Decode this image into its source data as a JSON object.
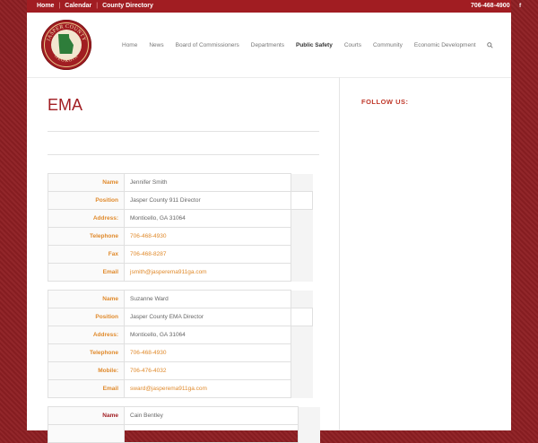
{
  "topbar": {
    "links": [
      "Home",
      "Calendar",
      "County Directory"
    ],
    "phone": "706-468-4900",
    "social": "f"
  },
  "logo": {
    "text_top": "JASPER COUNTY",
    "text_bottom": "GEORGIA"
  },
  "nav": {
    "items": [
      "Home",
      "News",
      "Board of Commissioners",
      "Departments",
      "Public Safety",
      "Courts",
      "Community",
      "Economic Development"
    ],
    "active": "Public Safety",
    "search_icon": "search-icon"
  },
  "page": {
    "title": "EMA"
  },
  "sidebar": {
    "heading": "FOLLOW US:"
  },
  "contacts": [
    {
      "rows": [
        {
          "label": "Name",
          "value": "Jennifer Smith"
        },
        {
          "label": "Position",
          "value": "Jasper County 911 Director"
        },
        {
          "label": "Address:",
          "value": "Monticello, GA 31064"
        },
        {
          "label": "Telephone",
          "value": "706-468-4930"
        },
        {
          "label": "Fax",
          "value": "706-468-8287"
        },
        {
          "label": "Email",
          "value": "jsmith@jasperema911ga.com"
        }
      ]
    },
    {
      "rows": [
        {
          "label": "Name",
          "value": "Suzanne Ward"
        },
        {
          "label": "Position",
          "value": "Jasper County EMA Director"
        },
        {
          "label": "Address:",
          "value": "Monticello, GA 31064"
        },
        {
          "label": "Telephone",
          "value": "706-468-4930"
        },
        {
          "label": "Mobile:",
          "value": "706-476-4032"
        },
        {
          "label": "Email",
          "value": "sward@jasperema911ga.com"
        }
      ]
    },
    {
      "rows": [
        {
          "label": "Name",
          "value": "Cain Bentley"
        }
      ]
    }
  ],
  "colors": {
    "brand": "#a11d22",
    "accent": "#e08a2c"
  }
}
